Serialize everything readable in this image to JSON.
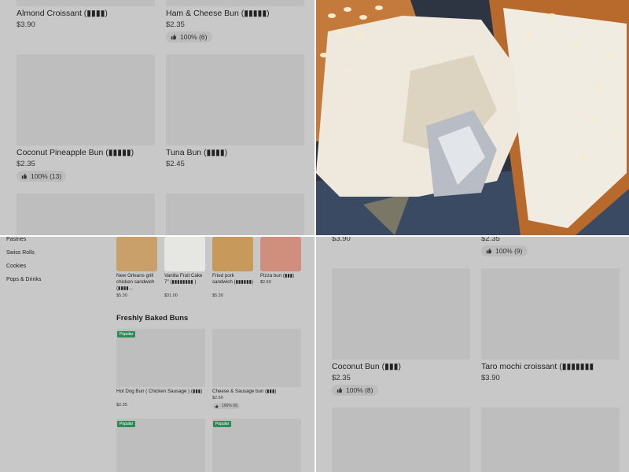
{
  "top_left": {
    "items": [
      {
        "name": "Almond Croissant (▮▮▮▮)",
        "price": "$3.90"
      },
      {
        "name": "Ham & Cheese Bun (▮▮▮▮▮)",
        "price": "$2.35",
        "rating": "100% (6)"
      },
      {
        "name": "Coconut Pineapple Bun (▮▮▮▮▮)",
        "price": "$2.35",
        "rating": "100% (13)"
      },
      {
        "name": "Tuna Bun (▮▮▮▮)",
        "price": "$2.45"
      }
    ]
  },
  "bottom_left": {
    "sidebar": [
      "Pastries",
      "Swiss Rolls",
      "Cookies",
      "Pops & Drinks"
    ],
    "featured": [
      {
        "name": "New Orleans grill chicken sandwich (▮▮▮▮...",
        "price": "$5.30"
      },
      {
        "name": "Vanilla Fruit Cake 7\" (▮▮▮▮▮▮▮▮ )",
        "price": "$31.00"
      },
      {
        "name": "Fried pork sandwich (▮▮▮▮▮▮)",
        "price": "$5.30"
      },
      {
        "name": "Pizza bun (▮▮▮)",
        "price": "$2.60"
      }
    ],
    "section_title": "Freshly Baked Buns",
    "buns": [
      {
        "name": "Hot Dog Bun ( Chicken Sausage ) (▮▮▮)",
        "price": "$2.35",
        "popular": "Popular"
      },
      {
        "name": "Cheese & Sausage bun (▮▮▮)",
        "price": "$2.60",
        "rating": "100% (6)"
      }
    ],
    "more_popular": [
      "Popular",
      "Popular"
    ]
  },
  "bottom_right": {
    "partial_top": {
      "price_left": "$3.90",
      "price_right": "$2.35",
      "rating_right": "100% (9)"
    },
    "items": [
      {
        "name": "Coconut Bun (▮▮▮)",
        "price": "$2.35",
        "rating": "100% (8)"
      },
      {
        "name": "Taro mochi croissant (▮▮▮▮▮▮▮",
        "price": "$3.90"
      }
    ]
  },
  "colors": {
    "overlay": "#c8c8c8",
    "popular_badge": "#2e8b57",
    "bread_crust": "#c47a3a"
  }
}
